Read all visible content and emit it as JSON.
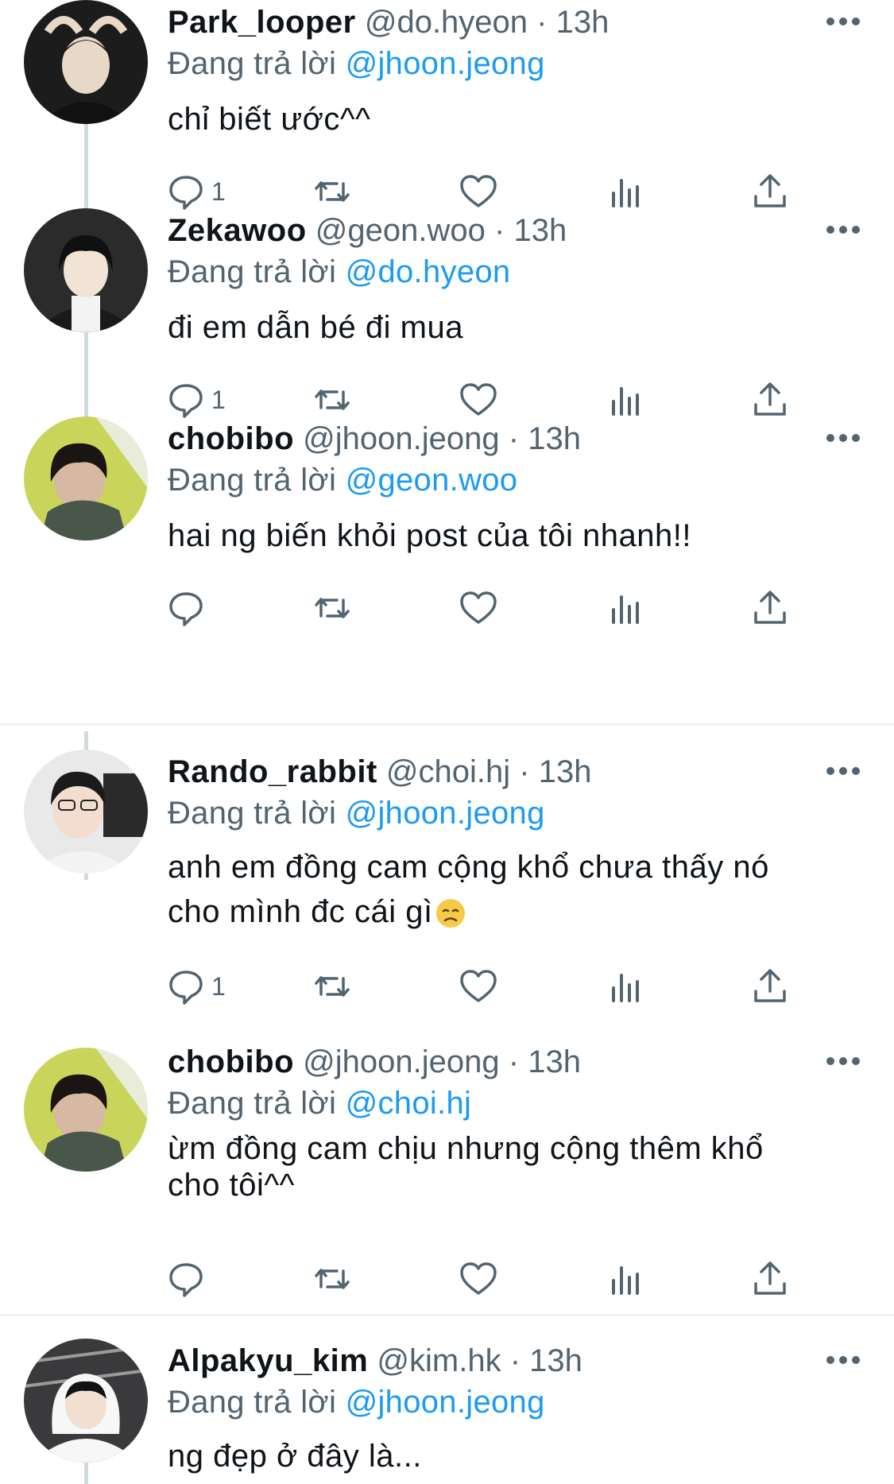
{
  "tweets": [
    {
      "name": "Park_looper",
      "handle": "@do.hyeon",
      "dot": "·",
      "time": "13h",
      "reply_prefix": "Đang trả lời",
      "reply_to": "@jhoon.jeong",
      "text_lines": [
        "chỉ biết ước^^"
      ],
      "reply_count": "1",
      "avatar": {
        "bg": "#1c1c1c",
        "face": "#e8d8c8",
        "hair": "#0d0d0d",
        "cloth": "#111111"
      }
    },
    {
      "name": "Zekawoo",
      "handle": "@geon.woo",
      "dot": "·",
      "time": "13h",
      "reply_prefix": "Đang trả lời",
      "reply_to": "@do.hyeon",
      "text_lines": [
        "đi em dẫn bé đi mua"
      ],
      "reply_count": "1",
      "avatar": {
        "bg": "#2b2b2b",
        "face": "#f1e3d6",
        "hair": "#101010",
        "cloth": "#1a1a1a"
      }
    },
    {
      "name": "chobibo",
      "handle": "@jhoon.jeong",
      "dot": "·",
      "time": "13h",
      "reply_prefix": "Đang trả lời",
      "reply_to": "@geon.woo",
      "text_lines": [
        "hai ng biến khỏi post của tôi nhanh!!"
      ],
      "reply_count": "",
      "avatar": {
        "bg": "#c9d45a",
        "face": "#d7b9a3",
        "hair": "#1a1512",
        "cloth": "#48574a"
      }
    },
    {
      "name": "Rando_rabbit",
      "handle": "@choi.hj",
      "dot": "·",
      "time": "13h",
      "reply_prefix": "Đang trả lời",
      "reply_to": "@jhoon.jeong",
      "text_lines": [
        "anh em đồng cam cộng khổ chưa thấy nó",
        "cho mình đc cái gì"
      ],
      "emoji": "😞",
      "reply_count": "1",
      "avatar": {
        "bg": "#e9e9ea",
        "face": "#f3ddd0",
        "hair": "#1b1b1b",
        "cloth": "#f4f4f4"
      }
    },
    {
      "name": "chobibo",
      "handle": "@jhoon.jeong",
      "dot": "·",
      "time": "13h",
      "reply_prefix": "Đang trả lời",
      "reply_to": "@choi.hj",
      "text_lines": [
        "ừm đồng cam chịu nhưng cộng thêm khổ",
        "cho tôi^^"
      ],
      "reply_count": "",
      "avatar": {
        "bg": "#c9d45a",
        "face": "#d7b9a3",
        "hair": "#1a1512",
        "cloth": "#48574a"
      }
    },
    {
      "name": "Alpakyu_kim",
      "handle": "@kim.hk",
      "dot": "·",
      "time": "13h",
      "reply_prefix": "Đang trả lời",
      "reply_to": "@jhoon.jeong",
      "text_lines": [
        "ng đẹp ở đây là..."
      ],
      "reply_count": "",
      "avatar": {
        "bg": "#3a3a3c",
        "face": "#f1dfd2",
        "hair": "#121212",
        "cloth": "#f7f7f7"
      }
    }
  ],
  "icons": {
    "reply": "speech-bubble-icon",
    "retweet": "retweet-icon",
    "like": "heart-icon",
    "views": "bar-chart-icon",
    "share": "share-upload-icon",
    "more": "more-dots-icon"
  },
  "colors": {
    "mention": "#1d9bf0",
    "secondary": "#536471",
    "icon": "#536471",
    "thread_line": "#cfd9de",
    "divider": "#eff3f4"
  }
}
